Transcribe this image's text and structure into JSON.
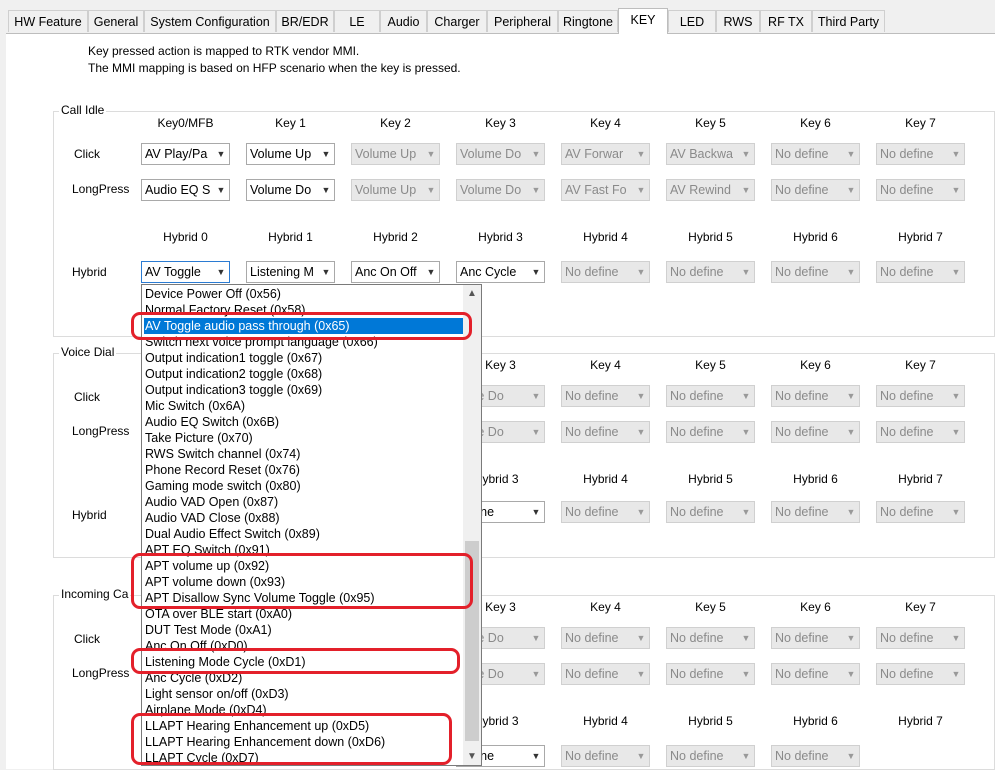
{
  "tabs": [
    "HW Feature",
    "General",
    "System Configuration",
    "BR/EDR",
    "LE",
    "Audio",
    "Charger",
    "Peripheral",
    "Ringtone",
    "KEY",
    "LED",
    "RWS",
    "RF TX",
    "Third Party"
  ],
  "active_tab": "KEY",
  "description": {
    "line1": "Key pressed action is mapped to RTK vendor MMI.",
    "line2": "The MMI mapping is based on HFP scenario when the key is pressed."
  },
  "call_idle": {
    "title": "Call Idle",
    "key_headers": [
      "Key0/MFB",
      "Key 1",
      "Key 2",
      "Key 3",
      "Key 4",
      "Key 5",
      "Key 6",
      "Key 7"
    ],
    "click_label": "Click",
    "click_values": [
      "AV Play/Pa",
      "Volume Up",
      "Volume Up",
      "Volume Do",
      "AV Forwar",
      "AV Backwa",
      "No define",
      "No define"
    ],
    "longpress_label": "LongPress",
    "longpress_values": [
      "Audio EQ S",
      "Volume Do",
      "Volume Up",
      "Volume Do",
      "AV Fast Fo",
      "AV Rewind",
      "No define",
      "No define"
    ],
    "hybrid_headers": [
      "Hybrid 0",
      "Hybrid 1",
      "Hybrid 2",
      "Hybrid 3",
      "Hybrid 4",
      "Hybrid 5",
      "Hybrid 6",
      "Hybrid 7"
    ],
    "hybrid_label": "Hybrid",
    "hybrid_values": [
      "AV Toggle",
      "Listening M",
      "Anc On Off",
      "Anc Cycle",
      "No define",
      "No define",
      "No define",
      "No define"
    ]
  },
  "voice_dial": {
    "title": "Voice Dial",
    "key_headers": [
      "Key 3",
      "Key 4",
      "Key 5",
      "Key 6",
      "Key 7"
    ],
    "click_label": "Click",
    "click_values": [
      "ume Do",
      "No define",
      "No define",
      "No define",
      "No define"
    ],
    "longpress_label": "LongPress",
    "longpress_values": [
      "ume Do",
      "No define",
      "No define",
      "No define",
      "No define"
    ],
    "hybrid_headers": [
      "ybrid 3",
      "Hybrid 4",
      "Hybrid 5",
      "Hybrid 6",
      "Hybrid 7"
    ],
    "hybrid_label": "Hybrid",
    "hybrid_values": [
      "define",
      "No define",
      "No define",
      "No define",
      "No define"
    ]
  },
  "incoming_call": {
    "title": "Incoming Ca",
    "key_headers": [
      "Key 3",
      "Key 4",
      "Key 5",
      "Key 6",
      "Key 7"
    ],
    "click_label": "Click",
    "click_values": [
      "ume Do",
      "No define",
      "No define",
      "No define",
      "No define"
    ],
    "longpress_label": "LongPress",
    "longpress_values": [
      "ume Do",
      "No define",
      "No define",
      "No define",
      "No define"
    ],
    "hybrid_headers": [
      "ybrid 3",
      "Hybrid 4",
      "Hybrid 5",
      "Hybrid 6",
      "Hybrid 7"
    ],
    "hybrid_label": "Hybrid",
    "hybrid_values": [
      "define",
      "No define",
      "No define",
      "No define"
    ]
  },
  "dropdown": {
    "items": [
      "Device Power Off  (0x56)",
      "Normal Factory Reset  (0x58)",
      "AV Toggle audio pass through  (0x65)",
      "Switch next voice prompt language  (0x66)",
      "Output indication1 toggle  (0x67)",
      "Output indication2 toggle  (0x68)",
      "Output indication3 toggle  (0x69)",
      "Mic Switch  (0x6A)",
      "Audio EQ Switch  (0x6B)",
      "Take Picture  (0x70)",
      "RWS Switch channel  (0x74)",
      "Phone Record Reset  (0x76)",
      "Gaming mode switch  (0x80)",
      "Audio VAD Open  (0x87)",
      "Audio VAD Close  (0x88)",
      "Dual Audio Effect Switch  (0x89)",
      "APT EQ Switch  (0x91)",
      "APT volume up  (0x92)",
      "APT volume down  (0x93)",
      "APT Disallow Sync Volume Toggle  (0x95)",
      "OTA over BLE start  (0xA0)",
      "DUT Test Mode  (0xA1)",
      "Anc On Off  (0xD0)",
      "Listening Mode Cycle  (0xD1)",
      "Anc Cycle  (0xD2)",
      "Light sensor on/off  (0xD3)",
      "Airplane Mode  (0xD4)",
      "LLAPT Hearing Enhancement up  (0xD5)",
      "LLAPT Hearing Enhancement down  (0xD6)",
      "LLAPT Cycle  (0xD7)"
    ],
    "selected_index": 2
  },
  "icons": {
    "combo_arrow": "chevron-down-icon",
    "scroll_up": "chevron-up-icon",
    "scroll_down": "chevron-down-icon"
  },
  "colors": {
    "highlight_box": "#e3202a",
    "selection": "#0078d7"
  }
}
